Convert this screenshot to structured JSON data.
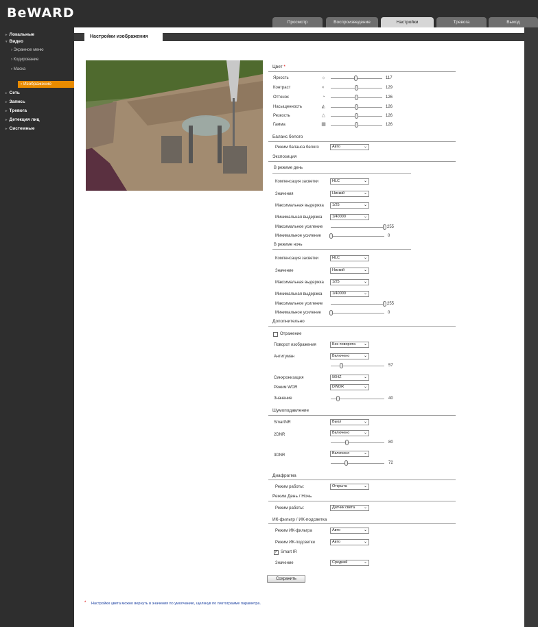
{
  "brand": {
    "logo": "BeWARD"
  },
  "tabs": [
    "Просмотр",
    "Воспроизведение",
    "Настройки",
    "Тревога",
    "Выход"
  ],
  "sidebar": {
    "local": "Локальные",
    "video": "Видео",
    "video_sub": [
      "Экранное меню",
      "Кодирование",
      "Маска",
      "Изображение"
    ],
    "items": [
      "Сеть",
      "Запись",
      "Тревога",
      "Детекция лиц",
      "Системные"
    ]
  },
  "page_title": "Настройки изображения",
  "colors": {
    "accent": "#e98b00",
    "panel": "#2e2e2e"
  },
  "color": {
    "title": "Цвет",
    "mark": "*",
    "rows": [
      {
        "label": "Яркость",
        "icon": "brightness-icon",
        "value": "117",
        "level": 0.48
      },
      {
        "label": "Контраст",
        "icon": "contrast-icon",
        "value": "129",
        "level": 0.5
      },
      {
        "label": "Оттенок",
        "icon": "hue-icon",
        "value": "126",
        "level": 0.5
      },
      {
        "label": "Насыщенность",
        "icon": "saturation-icon",
        "value": "126",
        "level": 0.5
      },
      {
        "label": "Резкость",
        "icon": "sharpness-icon",
        "value": "126",
        "level": 0.5
      },
      {
        "label": "Гамма",
        "icon": "gamma-icon",
        "value": "126",
        "level": 0.5
      }
    ]
  },
  "wb": {
    "title": "Баланс белого",
    "label": "Режим баланса белого",
    "value": "Авто"
  },
  "exposure": {
    "title": "Экспозиция",
    "day": {
      "title": "В режиме день",
      "comp_label": "Компенсация засветки",
      "comp_value": "HLC",
      "val_label": "Значения",
      "val_value": "Низкий",
      "maxexp_label": "Максимальная выдержка",
      "maxexp_value": "1/25",
      "minexp_label": "Минимальная выдержка",
      "minexp_value": "1/40000",
      "maxgain_label": "Максимальное усиление",
      "maxgain_value": "255",
      "maxgain_level": 1.0,
      "mingain_label": "Минимальное усиление",
      "mingain_value": "0",
      "mingain_level": 0.0
    },
    "night": {
      "title": "В режиме ночь",
      "comp_label": "Компенсация засветки",
      "comp_value": "HLC",
      "val_label": "Значение",
      "val_value": "Низкий",
      "maxexp_label": "Максимальная выдержка",
      "maxexp_value": "1/25",
      "minexp_label": "Минимальная выдержка",
      "minexp_value": "1/40000",
      "maxgain_label": "Максимальное усиление",
      "maxgain_value": "255",
      "maxgain_level": 1.0,
      "mingain_label": "Минимальное усиление",
      "mingain_value": "0",
      "mingain_level": 0.0
    }
  },
  "extra": {
    "title": "Дополнительно",
    "mirror_label": "Отражение",
    "mirror_checked": false,
    "rotate_label": "Поворот изображения",
    "rotate_value": "Без поворота",
    "antifog_label": "Антитуман",
    "antifog_value": "Включено",
    "antifog_num": "57",
    "antifog_level": 0.2,
    "sync_label": "Синхронизация",
    "sync_value": "50HZ",
    "wdr_label": "Режим WDR",
    "wdr_value": "DWDR",
    "wdrval_label": "Значение",
    "wdrval_num": "40",
    "wdrval_level": 0.13
  },
  "noise": {
    "title": "Шумоподавление",
    "smart_label": "SmartNR",
    "smart_value": "Выкл",
    "d2_label": "2DNR",
    "d2_value": "Включено",
    "d2_num": "80",
    "d2_level": 0.3,
    "d3_label": "3DNR",
    "d3_value": "Включено",
    "d3_num": "72",
    "d3_level": 0.29
  },
  "iris": {
    "title": "Диафрагма",
    "label": "Режим работы:",
    "value": "Открыта"
  },
  "daynight": {
    "title": "Режим День / Ночь",
    "label": "Режим работы:",
    "value": "Датчик света"
  },
  "ir": {
    "title": "ИК-фильтр / ИК-подсветка",
    "filter_label": "Режим ИК-фильтра",
    "filter_value": "Авто",
    "light_label": "Режим ИК-подсветки",
    "light_value": "Авто",
    "smart_label": "Smart IR",
    "smart_checked": true,
    "val_label": "Значение",
    "val_value": "Средний"
  },
  "save_label": "Сохранить",
  "note_mark": "*",
  "note": "Настройки цвета можно вернуть в значения по умолчанию, щелкнув по пиктограмме параметра."
}
